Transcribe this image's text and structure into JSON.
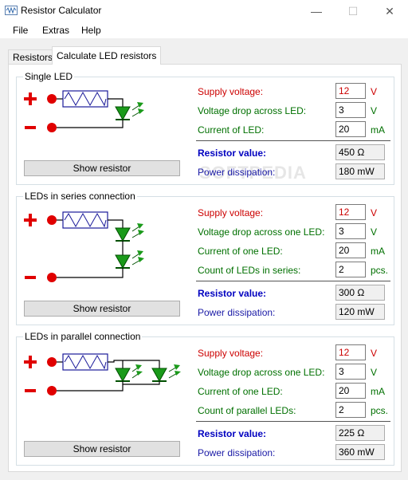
{
  "window": {
    "title": "Resistor Calculator",
    "minimize": "—",
    "maximize": "☐",
    "close": "✕"
  },
  "menu": [
    "File",
    "Extras",
    "Help"
  ],
  "tabs": [
    "Resistors",
    "Calculate LED resistors"
  ],
  "watermark": "SOFTPEDIA",
  "single": {
    "title": "Single LED",
    "supply_label": "Supply voltage:",
    "supply_value": "12",
    "supply_unit": "V",
    "drop_label": "Voltage drop across LED:",
    "drop_value": "3",
    "drop_unit": "V",
    "current_label": "Current of LED:",
    "current_value": "20",
    "current_unit": "mA",
    "resistor_label": "Resistor value:",
    "resistor_value": "450 Ω",
    "power_label": "Power dissipation:",
    "power_value": "180 mW",
    "button": "Show resistor"
  },
  "series": {
    "title": "LEDs in series connection",
    "supply_label": "Supply voltage:",
    "supply_value": "12",
    "supply_unit": "V",
    "drop_label": "Voltage drop across one LED:",
    "drop_value": "3",
    "drop_unit": "V",
    "current_label": "Current of one LED:",
    "current_value": "20",
    "current_unit": "mA",
    "count_label": "Count of LEDs in series:",
    "count_value": "2",
    "count_unit": "pcs.",
    "resistor_label": "Resistor value:",
    "resistor_value": "300 Ω",
    "power_label": "Power dissipation:",
    "power_value": "120 mW",
    "button": "Show resistor"
  },
  "parallel": {
    "title": "LEDs in parallel connection",
    "supply_label": "Supply voltage:",
    "supply_value": "12",
    "supply_unit": "V",
    "drop_label": "Voltage drop across one LED:",
    "drop_value": "3",
    "drop_unit": "V",
    "current_label": "Current of one LED:",
    "current_value": "20",
    "current_unit": "mA",
    "count_label": "Count of parallel LEDs:",
    "count_value": "2",
    "count_unit": "pcs.",
    "resistor_label": "Resistor value:",
    "resistor_value": "225 Ω",
    "power_label": "Power dissipation:",
    "power_value": "360 mW",
    "button": "Show resistor"
  },
  "colors": {
    "supply": "#cc0000",
    "green": "#007000",
    "blue": "#1a1aa6",
    "resistor_label": "#0000c0"
  }
}
